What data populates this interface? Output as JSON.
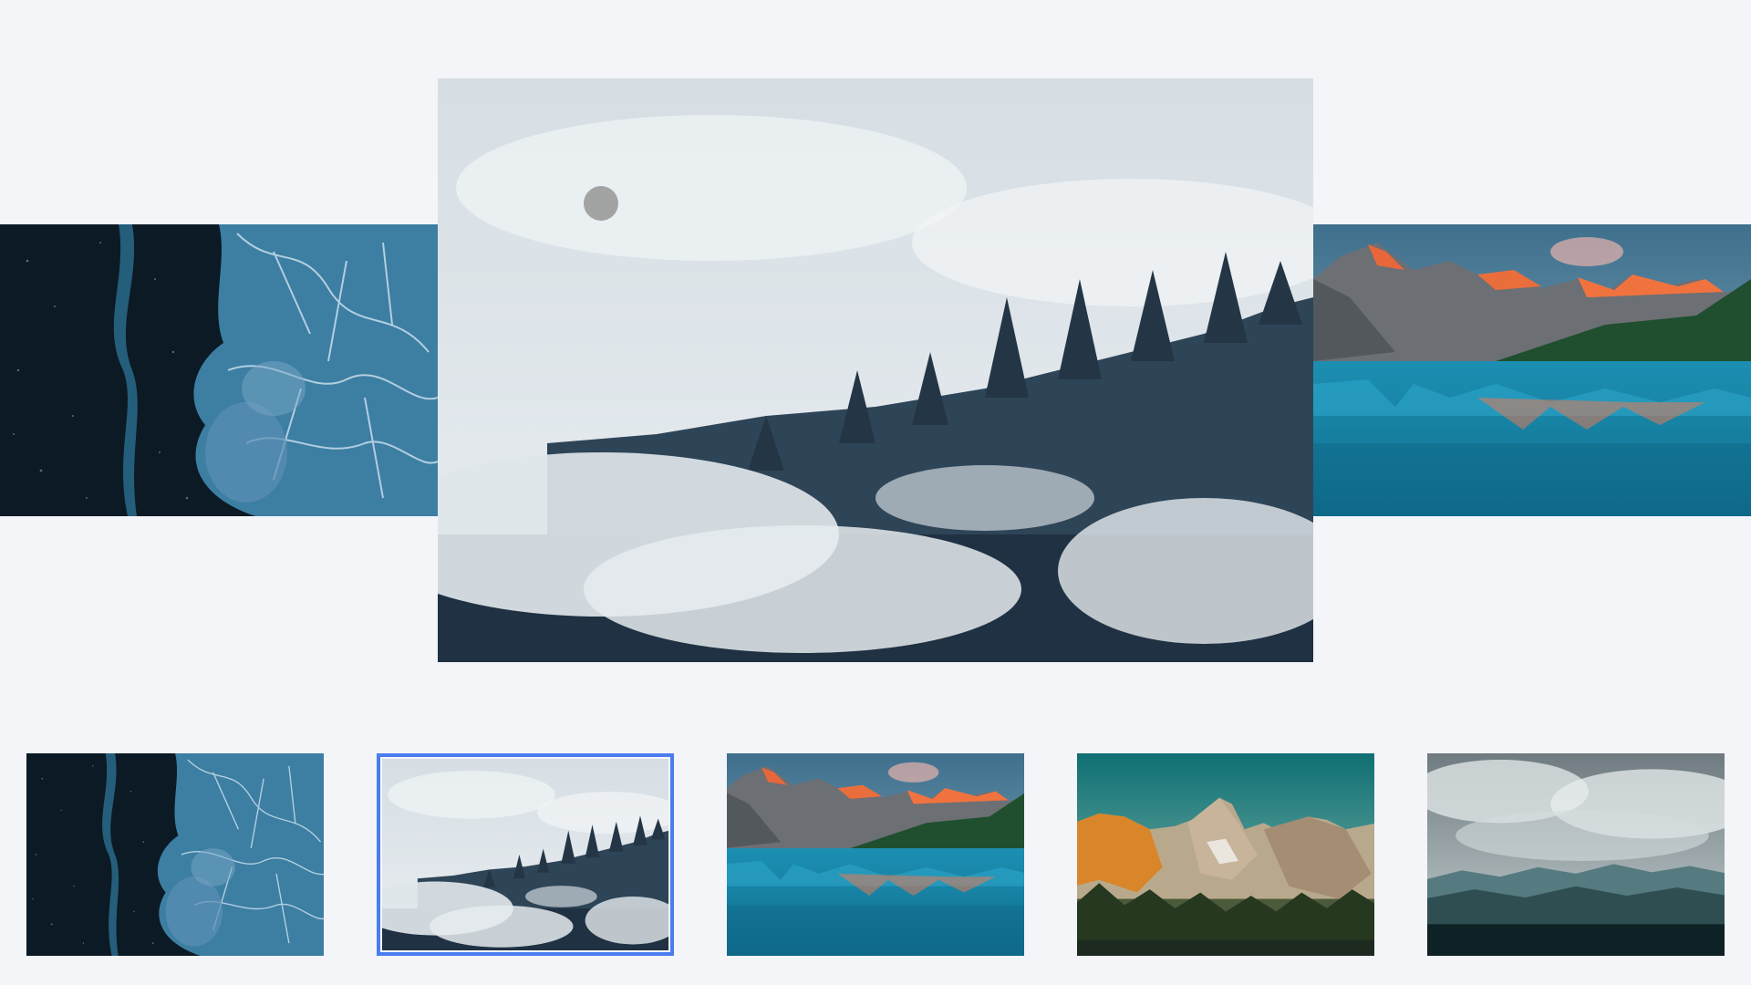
{
  "carousel": {
    "active_index": 2,
    "slides": [
      {
        "icon": "ice-crystals-image"
      },
      {
        "icon": "misty-forest-image"
      },
      {
        "icon": "mountain-lake-image"
      }
    ]
  },
  "thumbnails": {
    "selected_index": 2,
    "items": [
      {
        "icon": "ice-crystals-thumbnail"
      },
      {
        "icon": "misty-forest-thumbnail"
      },
      {
        "icon": "mountain-lake-thumbnail"
      },
      {
        "icon": "golden-peaks-thumbnail"
      },
      {
        "icon": "cloudy-mountains-thumbnail"
      }
    ]
  },
  "colors": {
    "background": "#f3f5f9",
    "selected_border": "#4a7cf0",
    "cursor": "#9e9e9e"
  }
}
